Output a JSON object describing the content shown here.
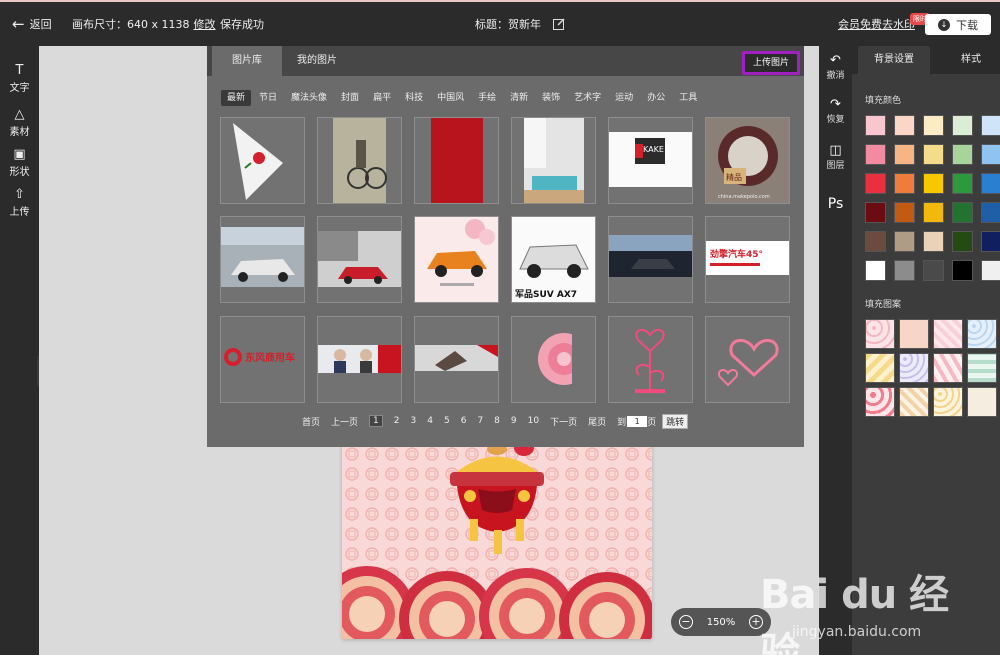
{
  "topbar": {
    "back": "返回",
    "canvas_size": "画布尺寸：640 x 1138",
    "edit": "修改",
    "save_status": "保存成功",
    "title": "标题：贺新年",
    "vip": "会员免费去水印",
    "badge": "限时",
    "download": "下载"
  },
  "left_tools": [
    "文字",
    "素材",
    "形状",
    "上传"
  ],
  "right_tools": [
    "撤消",
    "恢复",
    "图层",
    "Ps"
  ],
  "right_panel": {
    "tabs": [
      "背景设置",
      "样式"
    ],
    "fill_color_label": "填充颜色",
    "fill_pattern_label": "填充图案",
    "colors": [
      [
        "#f9c6d0",
        "#fbd5c6",
        "#fdebc6",
        "#dcedd5",
        "#cfe4f8"
      ],
      [
        "#f28aa0",
        "#f7b586",
        "#f5dc8a",
        "#a8d39a",
        "#8fc4f0"
      ],
      [
        "#e8303f",
        "#f07c3b",
        "#f7c700",
        "#2c9a3c",
        "#2a7fd0"
      ],
      [
        "#6b0c13",
        "#c25a14",
        "#f2b90c",
        "#237330",
        "#1f5fa8"
      ],
      [
        "#6b4b3e",
        "#b09c86",
        "#e9d2b8",
        "#254a14",
        "#0f1f60"
      ],
      [
        "#ffffff",
        "#8c8c8c",
        "#4a4a4a",
        "#000000",
        "#f0f0f0"
      ]
    ]
  },
  "library": {
    "tabs": [
      "图片库",
      "我的图片"
    ],
    "upload": "上传图片",
    "categories": [
      "最新",
      "节日",
      "魔法头像",
      "封面",
      "扁平",
      "科技",
      "中国风",
      "手绘",
      "清新",
      "装饰",
      "艺术字",
      "运动",
      "办公",
      "工具"
    ],
    "thumb_texts": {
      "t5": "KAKE",
      "t6a": "精品",
      "t6b": "china.makepolo.com",
      "t10": "军品SUV AX7",
      "t12": "劲擎汽车45°",
      "t13": "东风商用车"
    },
    "pager": {
      "first": "首页",
      "prev": "上一页",
      "pages": [
        "1",
        "2",
        "3",
        "4",
        "5",
        "6",
        "7",
        "8",
        "9",
        "10"
      ],
      "next": "下一页",
      "last": "尾页",
      "goto_prefix": "到",
      "goto_value": "1",
      "goto_suffix": "页",
      "go": "跳转"
    }
  },
  "zoom": {
    "level": "150%"
  },
  "watermark": {
    "main": "Bai du 经验",
    "sub": "jingyan.baidu.com"
  }
}
